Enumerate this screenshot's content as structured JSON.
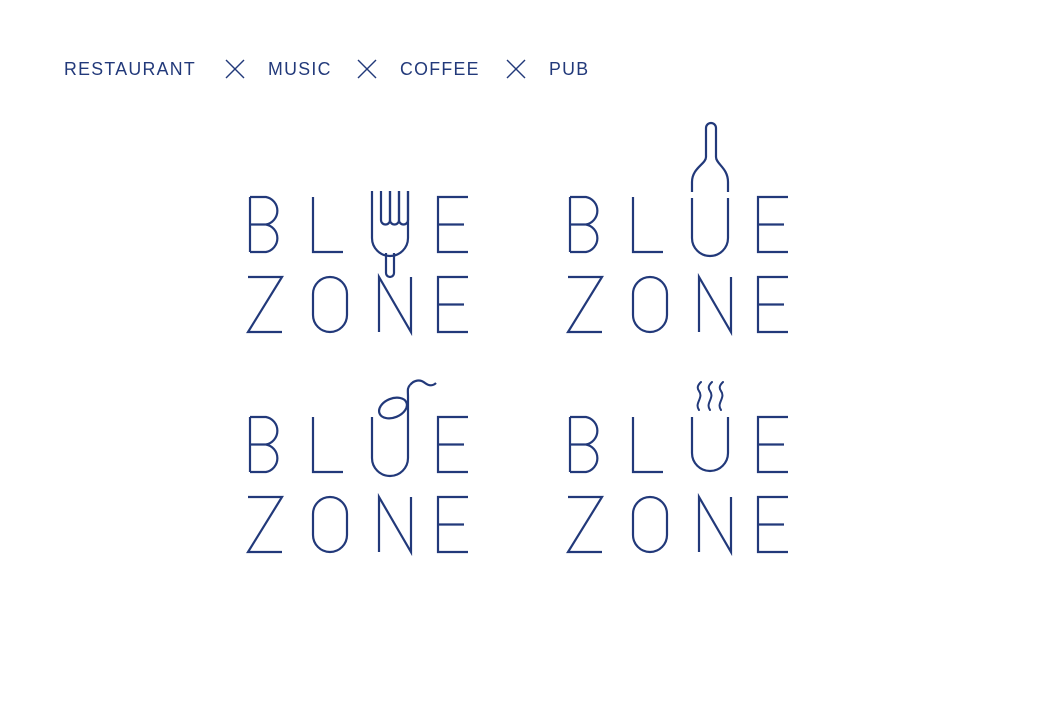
{
  "page": {
    "background_color": "#ffffff",
    "brand_color": "#22397a"
  },
  "nav": {
    "items": [
      {
        "label": "RESTAURANT"
      },
      {
        "label": "MUSIC"
      },
      {
        "label": "COFFEE"
      },
      {
        "label": "PUB"
      }
    ],
    "separator": "x-separator-icon"
  },
  "logos": [
    {
      "id": "restaurant",
      "variant_name": "RESTAURANT",
      "line1": "BLUE",
      "line2": "ZONE",
      "substituted_letter": "U",
      "icon": "fork-icon",
      "icon_description": "four-tine fork replacing the letter U"
    },
    {
      "id": "pub",
      "variant_name": "PUB",
      "line1": "BLUE",
      "line2": "ZONE",
      "substituted_letter": "U",
      "icon": "wine-bottle-icon",
      "icon_description": "wine bottle forming the letter U"
    },
    {
      "id": "music",
      "variant_name": "MUSIC",
      "line1": "BLUE",
      "line2": "ZONE",
      "substituted_letter": "U",
      "icon": "music-note-icon",
      "icon_description": "eighth note whose stem is the right side of the U"
    },
    {
      "id": "coffee",
      "variant_name": "COFFEE",
      "line1": "BLUE",
      "line2": "ZONE",
      "substituted_letter": "U",
      "icon": "coffee-steam-icon",
      "icon_description": "cup-shaped U with three rising steam wisps"
    }
  ]
}
